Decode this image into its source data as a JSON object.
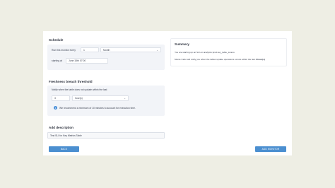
{
  "schedule": {
    "title": "Schedule",
    "run_label": "Run this monitor every",
    "run_value": "1",
    "unit_value": "Month",
    "starting_label": "starting at",
    "starting_value": "June 15th 07:00"
  },
  "freshness": {
    "title": "Freshness breach threshold",
    "notify_label": "Notify when the table does not update within the last",
    "threshold_value": "3",
    "threshold_unit": "hour(s)",
    "info_text": "We recommend a minimum of 10 minutes to account for execution time."
  },
  "description": {
    "title": "Add description",
    "value": "Test SLI for Key Metrics Table"
  },
  "summary": {
    "title": "Summary",
    "line1": "You are starting up an SLI on analytics:prod.key_table_scores",
    "line2_prefix": "Monte Carlo will notify you when the tables update operations occurs within the last",
    "line2_bold": "3 hour(s)"
  },
  "buttons": {
    "back": "BACK",
    "add_monitor": "ADD MONITOR"
  },
  "icons": {
    "caret": "chevron-down-icon",
    "info": "info-icon"
  },
  "colors": {
    "primary": "#4b8fd0",
    "background": "#eeeee4"
  }
}
